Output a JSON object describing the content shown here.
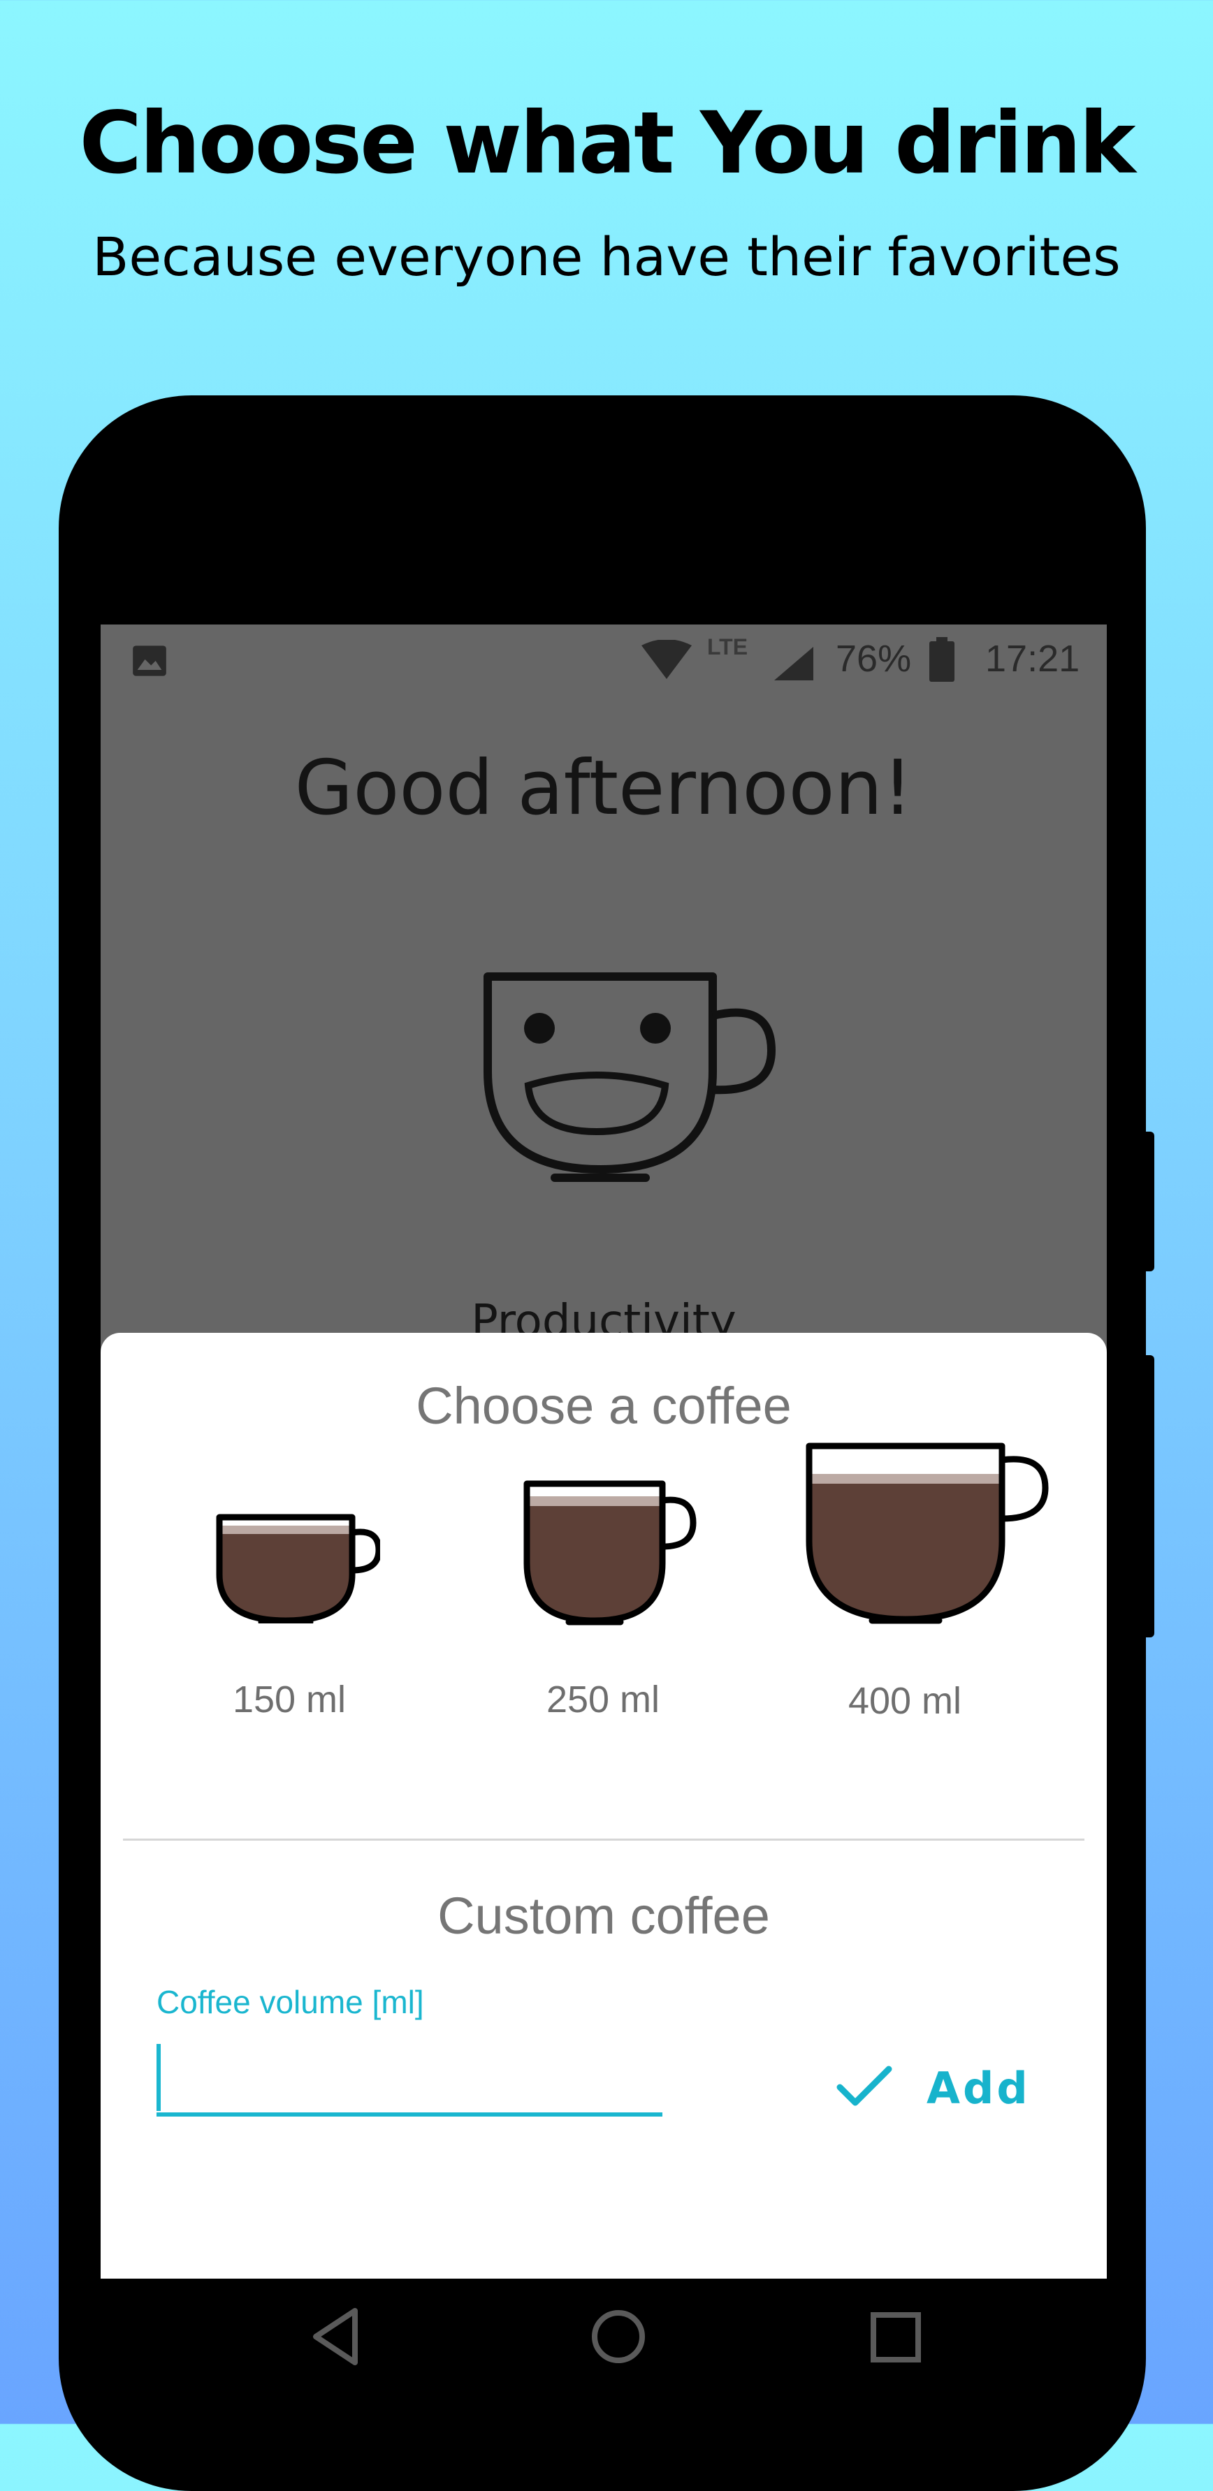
{
  "promo": {
    "headline": "Choose what You drink",
    "subheadline": "Because everyone have their favorites"
  },
  "status_bar": {
    "network": "LTE",
    "battery_percent": "76%",
    "time": "17:21",
    "icons": [
      "image-notification-icon",
      "wifi-icon",
      "cell-signal-icon",
      "battery-icon"
    ]
  },
  "home": {
    "greeting": "Good afternoon!",
    "mascot_icon": "smiling-coffee-cup-icon",
    "productivity_label": "Productivity"
  },
  "sheet": {
    "title": "Choose a coffee",
    "options": [
      {
        "label": "150 ml",
        "icon": "small-coffee-cup-icon"
      },
      {
        "label": "250 ml",
        "icon": "medium-coffee-cup-icon"
      },
      {
        "label": "400 ml",
        "icon": "large-coffee-cup-icon"
      }
    ],
    "custom_title": "Custom coffee",
    "field_label": "Coffee volume [ml]",
    "field_value": "",
    "add_label": "Add"
  },
  "nav": {
    "icons": [
      "back-icon",
      "home-icon",
      "recents-icon"
    ]
  },
  "colors": {
    "accent": "#1ab6cf",
    "coffee": "#5d4037",
    "crema": "#bcaaa4",
    "dim_overlay": "#666666"
  }
}
